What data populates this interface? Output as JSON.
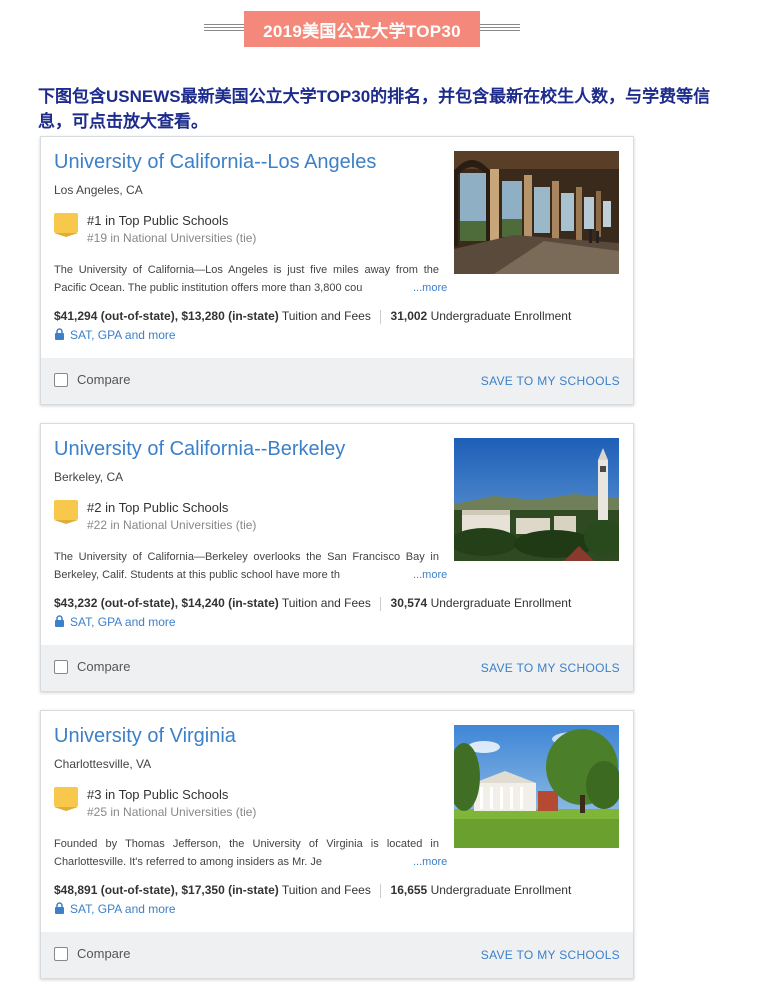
{
  "header": {
    "title": "2019美国公立大学TOP30"
  },
  "intro": "下图包含USNEWS最新美国公立大学TOP30的排名，并包含最新在校生人数，与学费等信息，可点击放大查看。",
  "cards": [
    {
      "name": "University of California--Los Angeles",
      "location": "Los Angeles, CA",
      "rank": "#1 in Top Public Schools",
      "rank_sub": "#19 in National Universities (tie)",
      "description": "The University of California—Los Angeles is just five miles away from the Pacific Ocean. The public institution offers more than 3,800 cou",
      "more": "...more",
      "tuition_value": "$41,294 (out-of-state), $13,280 (in-state)",
      "tuition_label": "Tuition and Fees",
      "enrollment_value": "31,002",
      "enrollment_label": "Undergraduate Enrollment",
      "sat": "SAT, GPA and more",
      "compare": "Compare",
      "save": "SAVE TO MY SCHOOLS",
      "photo": "ucla-arcade-photo"
    },
    {
      "name": "University of California--Berkeley",
      "location": "Berkeley, CA",
      "rank": "#2 in Top Public Schools",
      "rank_sub": "#22 in National Universities (tie)",
      "description": "The University of California—Berkeley overlooks the San Francisco Bay in Berkeley, Calif. Students at this public school have more th",
      "more": "...more",
      "tuition_value": "$43,232 (out-of-state), $14,240 (in-state)",
      "tuition_label": "Tuition and Fees",
      "enrollment_value": "30,574",
      "enrollment_label": "Undergraduate Enrollment",
      "sat": "SAT, GPA and more",
      "compare": "Compare",
      "save": "SAVE TO MY SCHOOLS",
      "photo": "berkeley-campus-photo"
    },
    {
      "name": "University of Virginia",
      "location": "Charlottesville, VA",
      "rank": "#3 in Top Public Schools",
      "rank_sub": "#25 in National Universities (tie)",
      "description": "Founded by Thomas Jefferson, the University of Virginia is located in Charlottesville. It's referred to among insiders as Mr. Je",
      "more": "...more",
      "tuition_value": "$48,891 (out-of-state), $17,350 (in-state)",
      "tuition_label": "Tuition and Fees",
      "enrollment_value": "16,655",
      "enrollment_label": "Undergraduate Enrollment",
      "sat": "SAT, GPA and more",
      "compare": "Compare",
      "save": "SAVE TO MY SCHOOLS",
      "photo": "uva-lawn-photo"
    }
  ],
  "colors": {
    "banner": "#f4897b",
    "intro_text": "#1d2c8c",
    "link": "#3c80c9",
    "rank_flag": "#f7c84c"
  }
}
